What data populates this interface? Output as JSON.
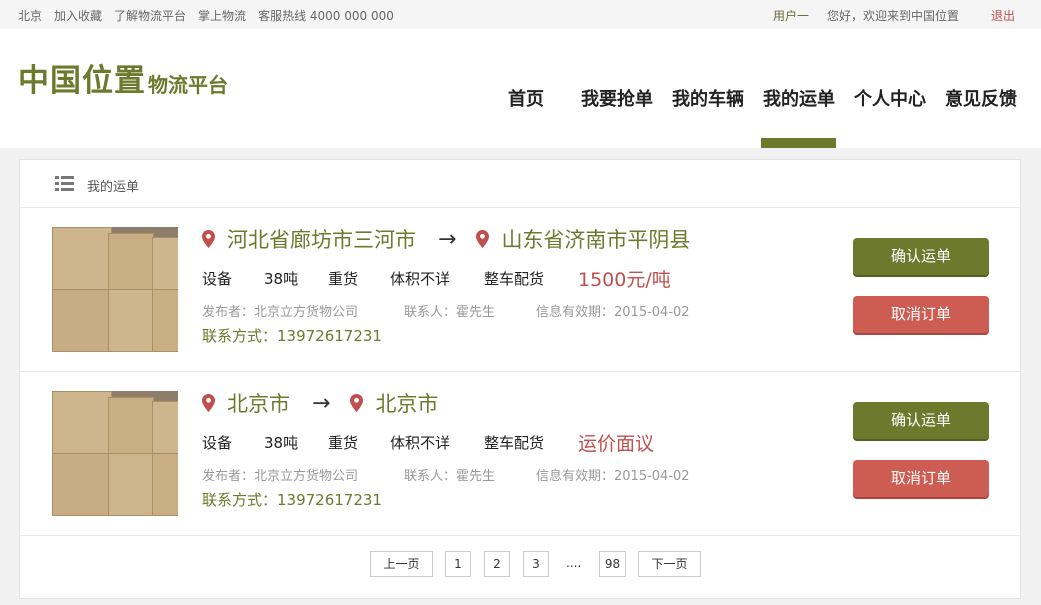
{
  "topbar": {
    "links": [
      "北京",
      "加入收藏",
      "了解物流平台",
      "掌上物流",
      "客服热线 4000 000 000"
    ],
    "user": "用户一",
    "welcome": "您好，欢迎来到中国位置",
    "logout": "退出"
  },
  "logo": {
    "main": "中国位置",
    "sub": "物流平台"
  },
  "nav": {
    "items": [
      "首页",
      "我要抢单",
      "我的车辆",
      "我的运单",
      "个人中心",
      "意见反馈"
    ],
    "active": "我的运单"
  },
  "breadcrumb": {
    "label": "我的运单"
  },
  "orders": [
    {
      "from": "河北省廊坊市三河市",
      "to": "山东省济南市平阴县",
      "cargo": "设备",
      "weight": "38吨",
      "type": "重货",
      "volume": "体积不详",
      "mode": "整车配货",
      "price": "1500元/吨",
      "publisher": "发布者：北京立方货物公司",
      "contact_person": "联系人：霍先生",
      "valid": "信息有效期：2015-04-02",
      "phone": "联系方式：13972617231",
      "confirm_label": "确认运单",
      "cancel_label": "取消订单"
    },
    {
      "from": "北京市",
      "to": "北京市",
      "cargo": "设备",
      "weight": "38吨",
      "type": "重货",
      "volume": "体积不详",
      "mode": "整车配货",
      "price": "运价面议",
      "publisher": "发布者：北京立方货物公司",
      "contact_person": "联系人：霍先生",
      "valid": "信息有效期：2015-04-02",
      "phone": "联系方式：13972617231",
      "confirm_label": "确认运单",
      "cancel_label": "取消订单"
    }
  ],
  "pager": {
    "prev": "上一页",
    "pages": [
      "1",
      "2",
      "3"
    ],
    "dots": "....",
    "last": "98",
    "next": "下一页"
  },
  "colors": {
    "brand": "#6d7a2e",
    "danger": "#cd5c53",
    "price": "#c0504d"
  }
}
